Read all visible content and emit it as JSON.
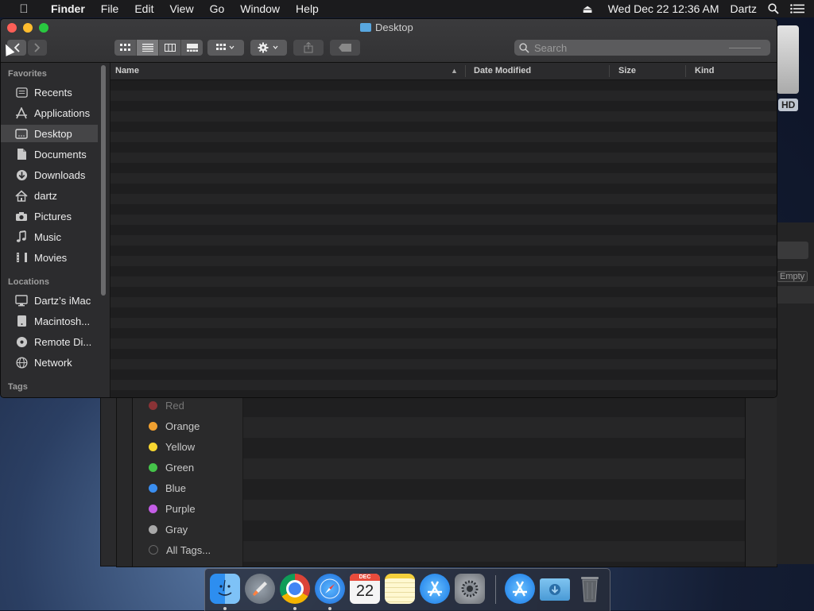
{
  "menubar": {
    "app_name": "Finder",
    "menus": [
      "File",
      "Edit",
      "View",
      "Go",
      "Window",
      "Help"
    ],
    "datetime": "Wed Dec 22  12:36 AM",
    "user": "Dartz"
  },
  "desktop": {
    "drive_label": "HD"
  },
  "background_window": {
    "empty_button": "Empty",
    "tags": [
      {
        "label": "Red",
        "color": "#c0464a"
      },
      {
        "label": "Orange",
        "color": "#f0a030"
      },
      {
        "label": "Yellow",
        "color": "#f8d730"
      },
      {
        "label": "Green",
        "color": "#45c44a"
      },
      {
        "label": "Blue",
        "color": "#3a8ef0"
      },
      {
        "label": "Purple",
        "color": "#c45de6"
      },
      {
        "label": "Gray",
        "color": "#a8a8a8"
      },
      {
        "label": "All Tags...",
        "color": "#555555"
      }
    ]
  },
  "window": {
    "title": "Desktop",
    "search_placeholder": "Search"
  },
  "sidebar": {
    "favorites_header": "Favorites",
    "favorites": [
      {
        "label": "Recents",
        "icon": "clock-icon"
      },
      {
        "label": "Applications",
        "icon": "applications-icon"
      },
      {
        "label": "Desktop",
        "icon": "desktop-icon",
        "selected": true
      },
      {
        "label": "Documents",
        "icon": "document-icon"
      },
      {
        "label": "Downloads",
        "icon": "download-icon"
      },
      {
        "label": "dartz",
        "icon": "home-icon"
      },
      {
        "label": "Pictures",
        "icon": "camera-icon"
      },
      {
        "label": "Music",
        "icon": "music-icon"
      },
      {
        "label": "Movies",
        "icon": "film-icon"
      }
    ],
    "locations_header": "Locations",
    "locations": [
      {
        "label": "Dartz’s iMac",
        "icon": "imac-icon"
      },
      {
        "label": "Macintosh...",
        "icon": "disk-icon"
      },
      {
        "label": "Remote Di...",
        "icon": "remote-disc-icon"
      },
      {
        "label": "Network",
        "icon": "globe-icon"
      }
    ],
    "tags_header": "Tags"
  },
  "list": {
    "columns": [
      "Name",
      "Date Modified",
      "Size",
      "Kind"
    ]
  },
  "dock": {
    "apps": [
      "Finder",
      "Launchpad",
      "Chrome",
      "Safari",
      "Calendar",
      "Notes",
      "App Store",
      "System Preferences",
      "App Store Downloads",
      "Downloads",
      "Trash"
    ],
    "calendar_month": "DEC",
    "calendar_day": "22"
  }
}
